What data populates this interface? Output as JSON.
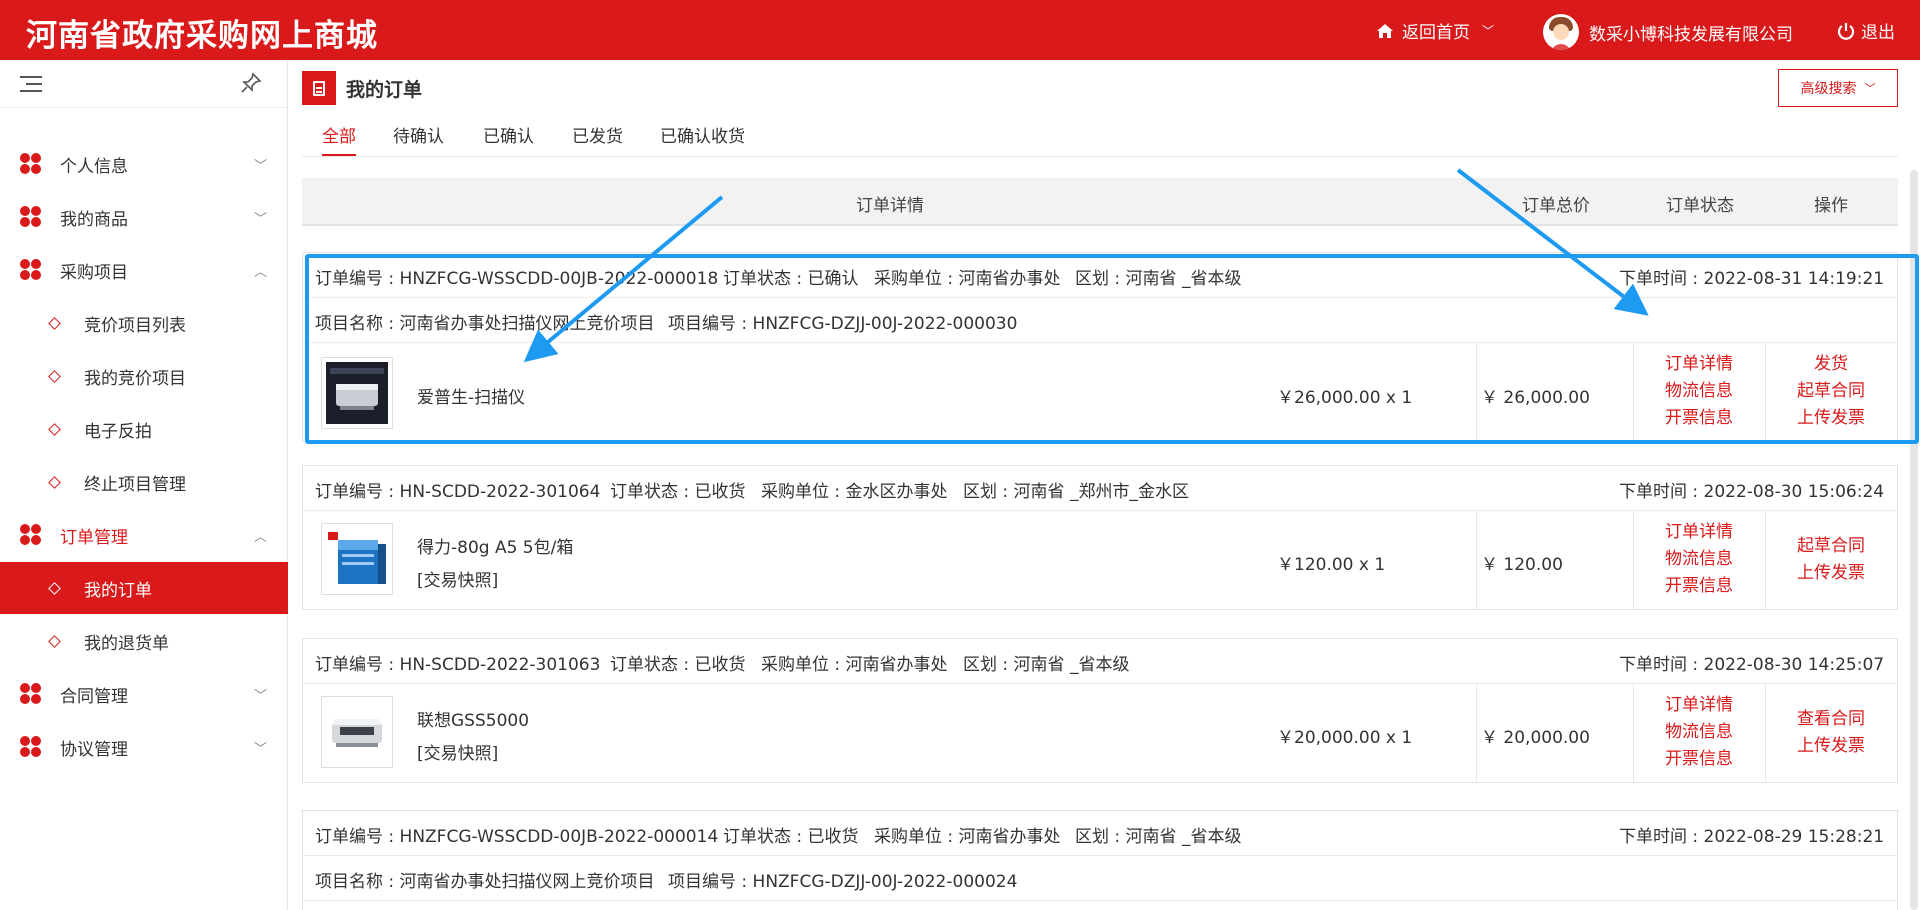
{
  "topbar": {
    "brand": "河南省政府采购网上商城",
    "home_label": "返回首页",
    "user_name": "数采小博科技发展有限公司",
    "logout_label": "退出"
  },
  "sidebar": {
    "items": [
      {
        "label": "个人信息"
      },
      {
        "label": "我的商品"
      },
      {
        "label": "采购项目"
      },
      {
        "label": "竞价项目列表"
      },
      {
        "label": "我的竞价项目"
      },
      {
        "label": "电子反拍"
      },
      {
        "label": "终止项目管理"
      },
      {
        "label": "订单管理"
      },
      {
        "label": "我的订单"
      },
      {
        "label": "我的退货单"
      },
      {
        "label": "合同管理"
      },
      {
        "label": "协议管理"
      }
    ]
  },
  "page": {
    "title": "我的订单",
    "adv_search": "高级搜索",
    "tabs": [
      "全部",
      "待确认",
      "已确认",
      "已发货",
      "已确认收货"
    ]
  },
  "table": {
    "headers": [
      "订单详情",
      "订单总价",
      "订单状态",
      "操作"
    ]
  },
  "orders": [
    {
      "order_no": "订单编号 : HNZFCG-WSSCDD-00JB-2022-000018",
      "status": "订单状态 : 已确认",
      "buyer": "采购单位 : 河南省办事处",
      "region": "区划 : 河南省 _省本级",
      "time": "下单时间 : 2022-08-31 14:19:21",
      "project_name": "项目名称 : 河南省办事处扫描仪网上竞价项目",
      "project_no": "项目编号 : HNZFCG-DZJJ-00J-2022-000030",
      "product": "爱普生-扫描仪",
      "unit_price": "￥26,000.00 x 1",
      "total": "￥ 26,000.00",
      "links": [
        "订单详情",
        "物流信息",
        "开票信息"
      ],
      "ops": [
        "发货",
        "起草合同",
        "上传发票"
      ]
    },
    {
      "order_no": "订单编号 : HN-SCDD-2022-301064",
      "status": "订单状态 : 已收货",
      "buyer": "采购单位 : 金水区办事处",
      "region": "区划 : 河南省 _郑州市_金水区",
      "time": "下单时间 : 2022-08-30 15:06:24",
      "product": "得力-80g A5 5包/箱",
      "snapshot": "[交易快照]",
      "unit_price": "￥120.00 x 1",
      "total": "￥ 120.00",
      "links": [
        "订单详情",
        "物流信息",
        "开票信息"
      ],
      "ops": [
        "起草合同",
        "上传发票"
      ]
    },
    {
      "order_no": "订单编号 : HN-SCDD-2022-301063",
      "status": "订单状态 : 已收货",
      "buyer": "采购单位 : 河南省办事处",
      "region": "区划 : 河南省 _省本级",
      "time": "下单时间 : 2022-08-30 14:25:07",
      "product": "联想GSS5000",
      "snapshot": "[交易快照]",
      "unit_price": "￥20,000.00 x 1",
      "total": "￥ 20,000.00",
      "links": [
        "订单详情",
        "物流信息",
        "开票信息"
      ],
      "ops": [
        "查看合同",
        "上传发票"
      ]
    },
    {
      "order_no": "订单编号 : HNZFCG-WSSCDD-00JB-2022-000014",
      "status": "订单状态 : 已收货",
      "buyer": "采购单位 : 河南省办事处",
      "region": "区划 : 河南省 _省本级",
      "time": "下单时间 : 2022-08-29 15:28:21",
      "project_name": "项目名称 : 河南省办事处扫描仪网上竞价项目",
      "project_no": "项目编号 : HNZFCG-DZJJ-00J-2022-000024"
    }
  ],
  "colors": {
    "brand_red": "#d9191a",
    "annotation_blue": "#1e9af2"
  }
}
